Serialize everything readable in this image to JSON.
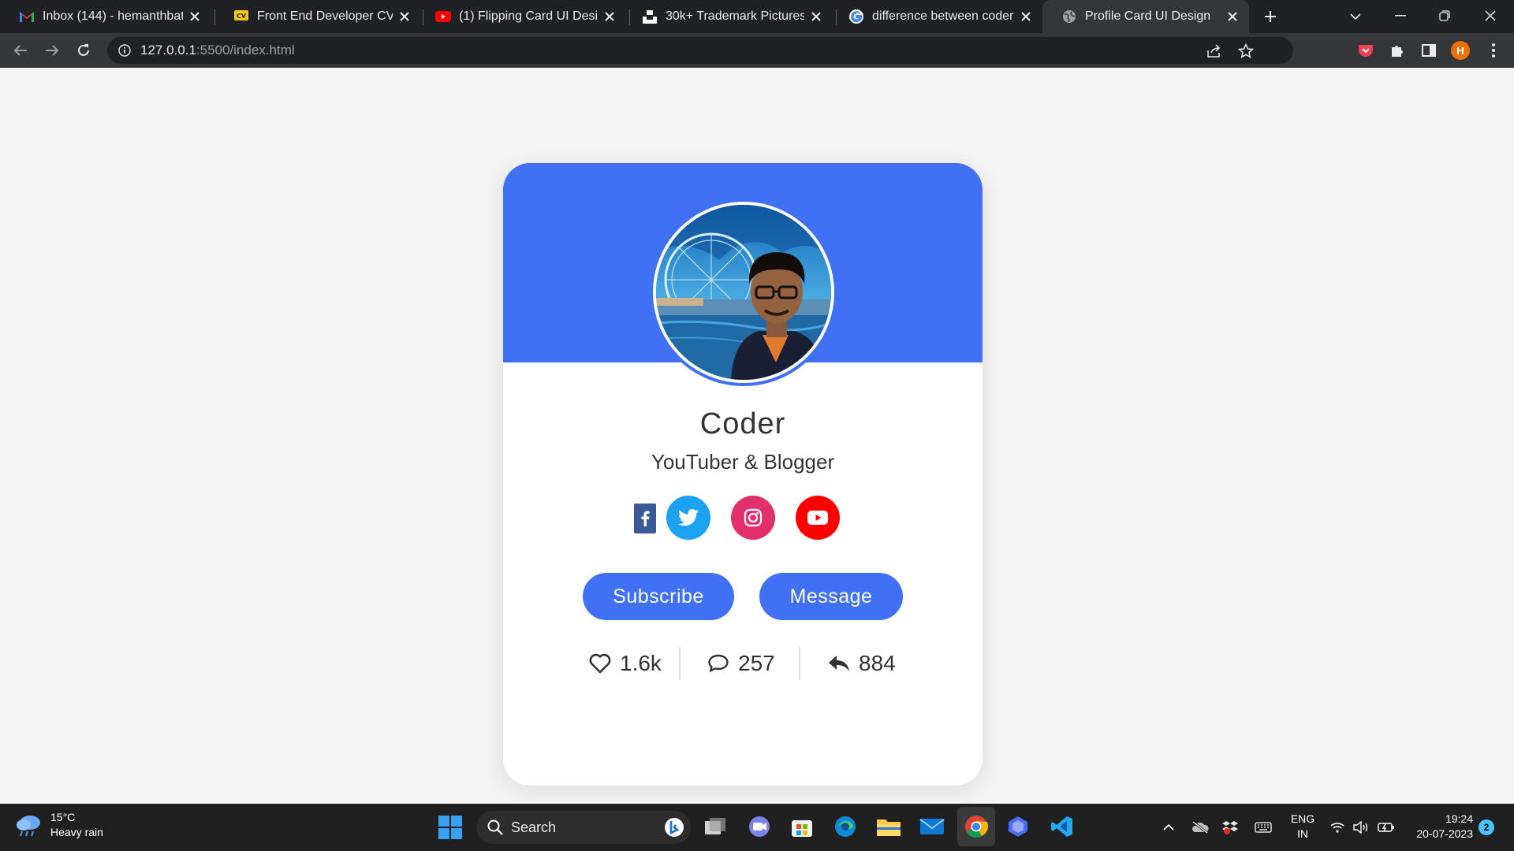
{
  "browser": {
    "tabs": [
      {
        "title": "Inbox (144) - hemanthbattu",
        "icon": "gmail-icon"
      },
      {
        "title": "Front End Developer CV Exa",
        "icon": "cv-icon"
      },
      {
        "title": "(1) Flipping Card UI Design",
        "icon": "youtube-icon"
      },
      {
        "title": "30k+ Trademark Pictures | D",
        "icon": "unsplash-icon"
      },
      {
        "title": "difference between coder a",
        "icon": "google-icon"
      },
      {
        "title": "Profile Card UI Design",
        "icon": "globe-icon",
        "active": true
      }
    ],
    "url_host": "127.0.0.1",
    "url_rest": ":5500/index.html",
    "profile_initial": "H"
  },
  "card": {
    "name": "Coder",
    "job": "YouTuber & Blogger",
    "social": [
      "facebook",
      "twitter",
      "instagram",
      "youtube"
    ],
    "buttons": {
      "subscribe": "Subscribe",
      "message": "Message"
    },
    "stats": {
      "likes": "1.6k",
      "comments": "257",
      "shares": "884"
    },
    "accent": "#4070f4"
  },
  "taskbar": {
    "weather_temp": "15°C",
    "weather_desc": "Heavy rain",
    "search_label": "Search",
    "lang_top": "ENG",
    "lang_bottom": "IN",
    "time": "19:24",
    "date": "20-07-2023",
    "notifications": "2"
  }
}
